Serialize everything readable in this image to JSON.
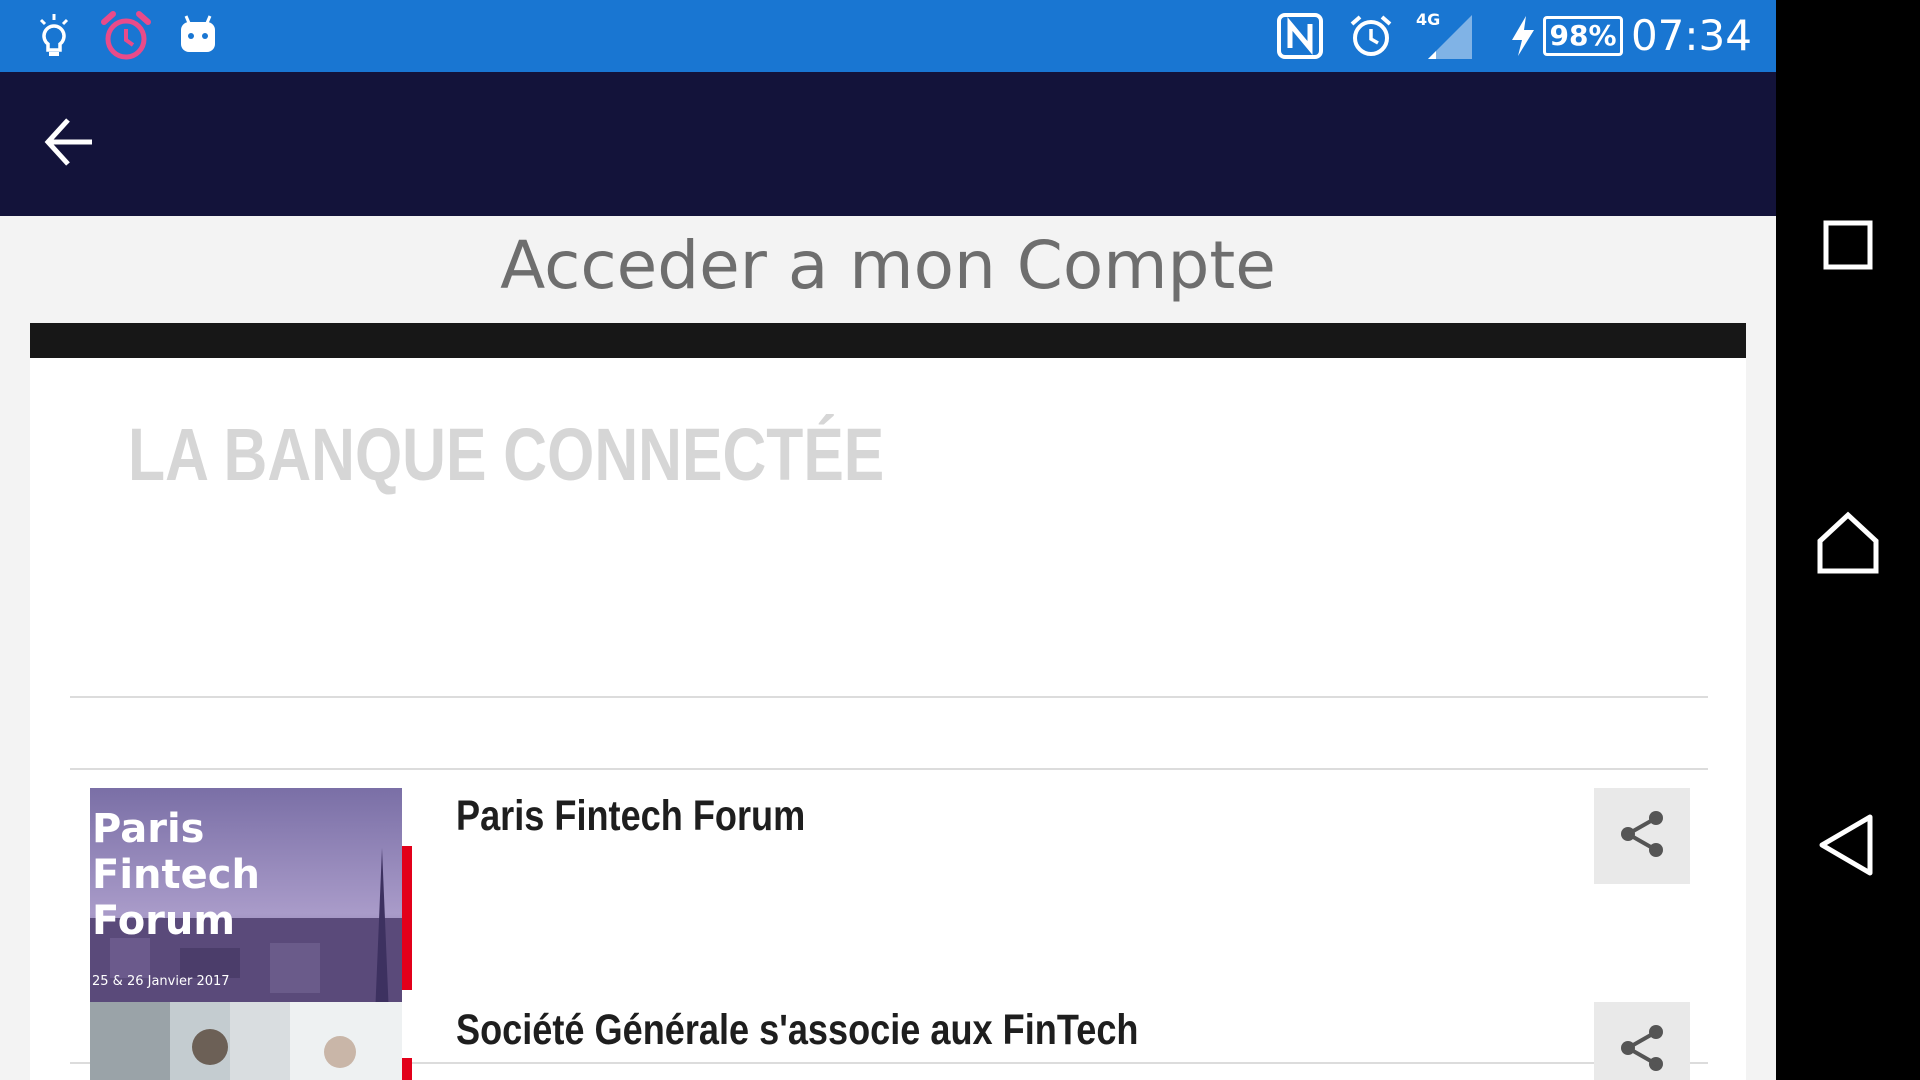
{
  "status_bar": {
    "icons_left": [
      "bulb-icon",
      "alarm-clock-pink-icon",
      "android-bot-icon"
    ],
    "icons_right": [
      "nfc-icon",
      "alarm-icon",
      "signal-4g-icon",
      "charging-icon",
      "battery-icon"
    ],
    "network": "4G",
    "battery_percent": "98%",
    "time": "07:34"
  },
  "app_bar": {
    "back_icon": "arrow-left-icon"
  },
  "page": {
    "title": "Acceder a mon Compte"
  },
  "section": {
    "title": "LA BANQUE CONNECTÉE"
  },
  "articles": [
    {
      "title": "Paris Fintech Forum",
      "thumbnail_text": [
        "Paris",
        "Fintech",
        "Forum"
      ],
      "thumbnail_sub": "25 & 26 Janvier 2017",
      "share_icon": "share-icon"
    },
    {
      "title": "Société Générale s'associe aux FinTech",
      "share_icon": "share-icon"
    }
  ],
  "nav_bar": {
    "buttons": [
      "recents-square-icon",
      "home-icon",
      "back-triangle-icon"
    ]
  },
  "colors": {
    "status_bar": "#1976d2",
    "app_bar": "#13133a",
    "accent_red": "#e2001a",
    "section_title": "#d6d6d6"
  }
}
